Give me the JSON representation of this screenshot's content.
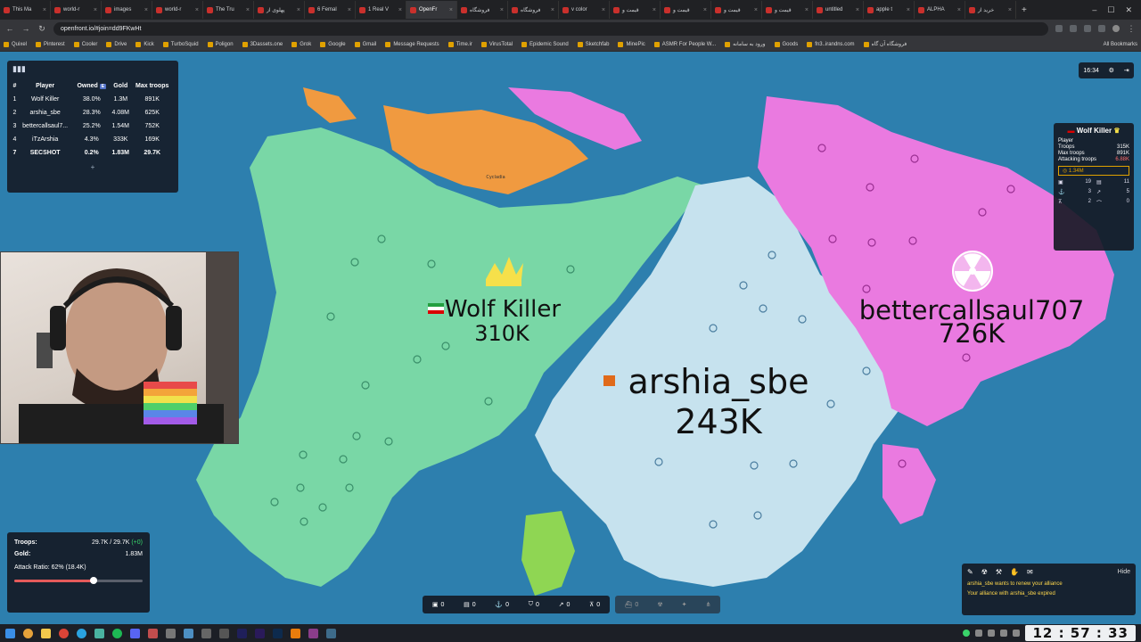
{
  "browser": {
    "tabs": [
      {
        "label": "This Ma"
      },
      {
        "label": "world-r"
      },
      {
        "label": "images"
      },
      {
        "label": "world-r"
      },
      {
        "label": "The Tru"
      },
      {
        "label": "پهلوی از"
      },
      {
        "label": "6 Femal"
      },
      {
        "label": "1 Real V"
      },
      {
        "label": "OpenFr",
        "active": true
      },
      {
        "label": "فروشگاه"
      },
      {
        "label": "فروشگاه"
      },
      {
        "label": "v color"
      },
      {
        "label": "قیمت و"
      },
      {
        "label": "قیمت و"
      },
      {
        "label": "قیمت و"
      },
      {
        "label": "قیمت و"
      },
      {
        "label": "untitled"
      },
      {
        "label": "apple t"
      },
      {
        "label": "ALPHA"
      },
      {
        "label": "خرید از"
      }
    ],
    "url": "openfront.io/#join=dd9FKwHt",
    "bookmarks": [
      "Quixel",
      "Pinterest",
      "Cooler",
      "Drive",
      "Kick",
      "TurboSquid",
      "Poligon",
      "3Dassets.one",
      "Grok",
      "Google",
      "Gmail",
      "Message Requests",
      "Time.ir",
      "VirusTotal",
      "Epidemic Sound",
      "Sketchfab",
      "MinePic",
      "ASMR For People W...",
      "ورود به سامانه",
      "Goods",
      "fn3..irandns.com",
      "فروشگاه آن گاه"
    ],
    "all_bookmarks": "All Bookmarks"
  },
  "leaderboard": {
    "headers": [
      "#",
      "Player",
      "Owned",
      "Gold",
      "Max troops"
    ],
    "owned_badge": "E",
    "rows": [
      {
        "rank": "1",
        "player": "Wolf Killer",
        "owned": "38.0%",
        "gold": "1.3M",
        "max": "891K"
      },
      {
        "rank": "2",
        "player": "arshia_sbe",
        "owned": "28.3%",
        "gold": "4.08M",
        "max": "625K"
      },
      {
        "rank": "3",
        "player": "bettercallsaul7...",
        "owned": "25.2%",
        "gold": "1.54M",
        "max": "752K"
      },
      {
        "rank": "4",
        "player": "iTzArshia",
        "owned": "4.3%",
        "gold": "333K",
        "max": "169K"
      },
      {
        "rank": "7",
        "player": "SECSHOT",
        "owned": "0.2%",
        "gold": "1.83M",
        "max": "29.7K",
        "me": true
      }
    ],
    "more": "+"
  },
  "map_labels": {
    "wolf_name": "Wolf Killer",
    "wolf_troops": "310K",
    "arshia_name": "arshia_sbe",
    "arshia_troops": "243K",
    "saul_name": "bettercallsaul707",
    "saul_troops": "726K",
    "small_orange": "Cycladia"
  },
  "top_right": {
    "time": "16:34"
  },
  "player_panel": {
    "name": "Wolf Killer",
    "type_label": "Player",
    "troops_label": "Troops",
    "troops_value": "315K",
    "max_troops_label": "Max troops",
    "max_troops_value": "891K",
    "attacking_label": "Attacking troops",
    "attacking_value": "6.88K",
    "gold": "1.34M",
    "cities": "19",
    "factories": "11",
    "ports": "3",
    "missile_silos": "5",
    "defense": "2",
    "sam": "0"
  },
  "stats": {
    "troops_label": "Troops:",
    "troops_value": "29.7K / 29.7K",
    "troops_delta": "(+0)",
    "gold_label": "Gold:",
    "gold_value": "1.83M",
    "attack_ratio_label": "Attack Ratio: 62% (18.4K)",
    "attack_ratio": 0.62
  },
  "build_bar": {
    "items": [
      "0",
      "0",
      "0",
      "0",
      "0",
      "0"
    ],
    "disabled_items": [
      "0"
    ]
  },
  "events": {
    "hide": "Hide",
    "messages": [
      "arshia_sbe wants to renew your alliance",
      "Your alliance with arshia_sbe expired"
    ]
  },
  "taskbar": {
    "clock": "12 : 57 : 33"
  },
  "colors": {
    "ocean": "#2d7fae",
    "wolf_territory": "#79d7a6",
    "arshia_territory": "#c6e2ee",
    "saul_territory": "#ea7ae0",
    "orange_territory": "#f09a40",
    "green_territory": "#8fd653"
  }
}
